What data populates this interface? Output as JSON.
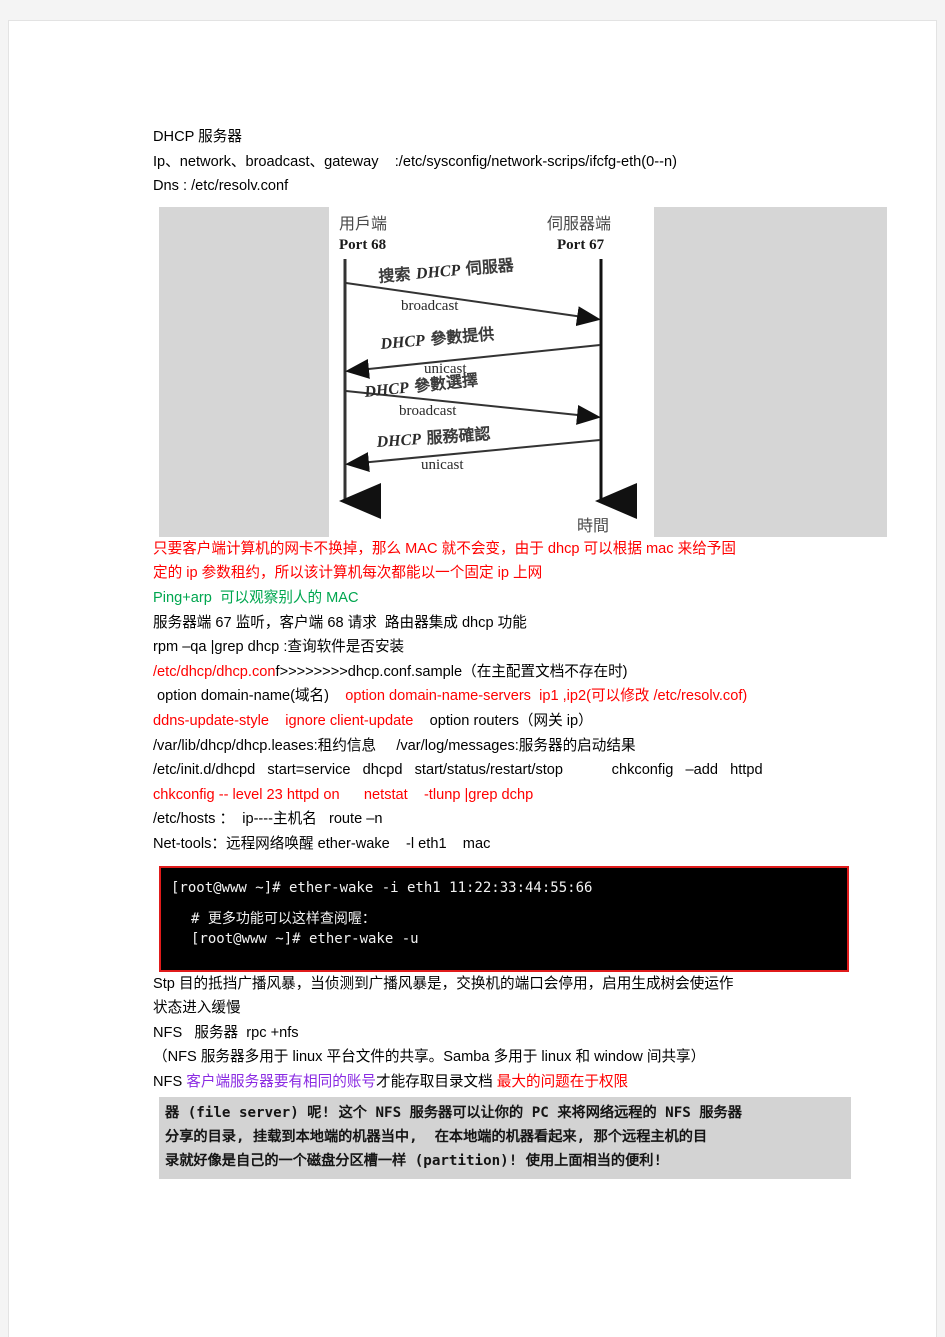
{
  "document": {
    "title": "DHCP 服务器",
    "lines_top": [
      {
        "id": "l1",
        "text": "DHCP 服务器"
      },
      {
        "id": "l2",
        "text": "Ip、network、broadcast、gateway    :/etc/sysconfig/network-scrips/ifcfg-eth(0--n)"
      },
      {
        "id": "l3",
        "text": "Dns : /etc/resolv.conf"
      }
    ]
  },
  "dhcp_diagram": {
    "client_label": "用戶端",
    "client_port": "Port 68",
    "server_label": "伺服器端",
    "server_port": "Port 67",
    "time_label": "時間",
    "messages": [
      {
        "title": "搜索 DHCP 伺服器",
        "cast": "broadcast",
        "direction": "client-to-server"
      },
      {
        "title": "DHCP 參數提供",
        "cast": "unicast",
        "direction": "server-to-client"
      },
      {
        "title": "DHCP 參數選擇",
        "cast": "broadcast",
        "direction": "client-to-server"
      },
      {
        "title": "DHCP 服務確認",
        "cast": "unicast",
        "direction": "server-to-client"
      }
    ]
  },
  "notes": {
    "mac_note_a": "只要客户端计算机的网卡不换掉，那么 MAC 就不会变，由于 dhcp 可以根据 mac 来给予固",
    "mac_note_b": "定的 ip 参数租约，所以该计算机每次都能以一个固定 ip 上网",
    "ping_arp_cmd": "Ping+arp",
    "ping_arp_desc": "可以观察别人的 MAC",
    "ports_line": "服务器端 67 监听，客户端 68 请求  路由器集成 dhcp 功能",
    "rpm_line": "rpm –qa |grep dhcp :查询软件是否安装",
    "conf_red": "/etc/dhcp/dhcp.con",
    "conf_black": "f>>>>>>>>dhcp.conf.sample（在主配置文档不存在时)",
    "option_black": " option domain-name(域名)",
    "option_red": "option domain-name-servers  ip1 ,ip2(可以修改 /etc/resolv.cof)",
    "ddns_red": "ddns-update-style    ignore client-update",
    "ddns_black": "option routers（网关 ip）",
    "leases_line": "/var/lib/dhcp/dhcp.leases:租约信息     /var/log/messages:服务器的启动结果",
    "initd_line": "/etc/init.d/dhcpd   start=service   dhcpd   start/status/restart/stop            chkconfig   –add   httpd",
    "chkconfig_red": "chkconfig -- level 23 httpd on      netstat    -tlunp |grep dchp",
    "hosts_line": "/etc/hosts ：  ip----主机名   route –n",
    "nettools_line": "Net-tools：远程网络唤醒 ether-wake    -l eth1    mac"
  },
  "terminal": {
    "lines": [
      "[root@www ~]# ether-wake -i eth1 11:22:33:44:55:66",
      "# 更多功能可以这样查阅喔：",
      "[root@www ~]# ether-wake -u"
    ]
  },
  "notes2": {
    "stp_a": "Stp 目的抵挡广播风暴，当侦测到广播风暴是，交换机的端口会停用，启用生成树会使运作",
    "stp_b": "状态进入缓慢",
    "nfs_line": "NFS   服务器  rpc +nfs",
    "nfs_paren": "（NFS 服务器多用于 linux 平台文件的共享。Samba 多用于 linux 和 window 间共享）",
    "nfs_mixed_black1": "NFS ",
    "nfs_mixed_purple": "客户端服务器要有相同的账号",
    "nfs_mixed_black2": "才能存取目录文档 ",
    "nfs_mixed_red": "最大的问题在于权限"
  },
  "nfs_quote": {
    "lines": [
      "器 (file server) 呢! 这个 NFS 服务器可以让你的 PC 来将网络远程的 NFS 服务器",
      "分享的目录, 挂载到本地端的机器当中,  在本地端的机器看起来, 那个远程主机的目",
      "录就好像是自己的一个磁盘分区槽一样 (partition)! 使用上面相当的便利!"
    ]
  },
  "colors": {
    "red": "#ff0000",
    "green": "#00a64f",
    "purple": "#8a2be2",
    "terminal_bg": "#000000",
    "terminal_border": "#e01b1b",
    "figure_bg": "#d6d6d6",
    "quote_bg": "#d3d3d3"
  }
}
